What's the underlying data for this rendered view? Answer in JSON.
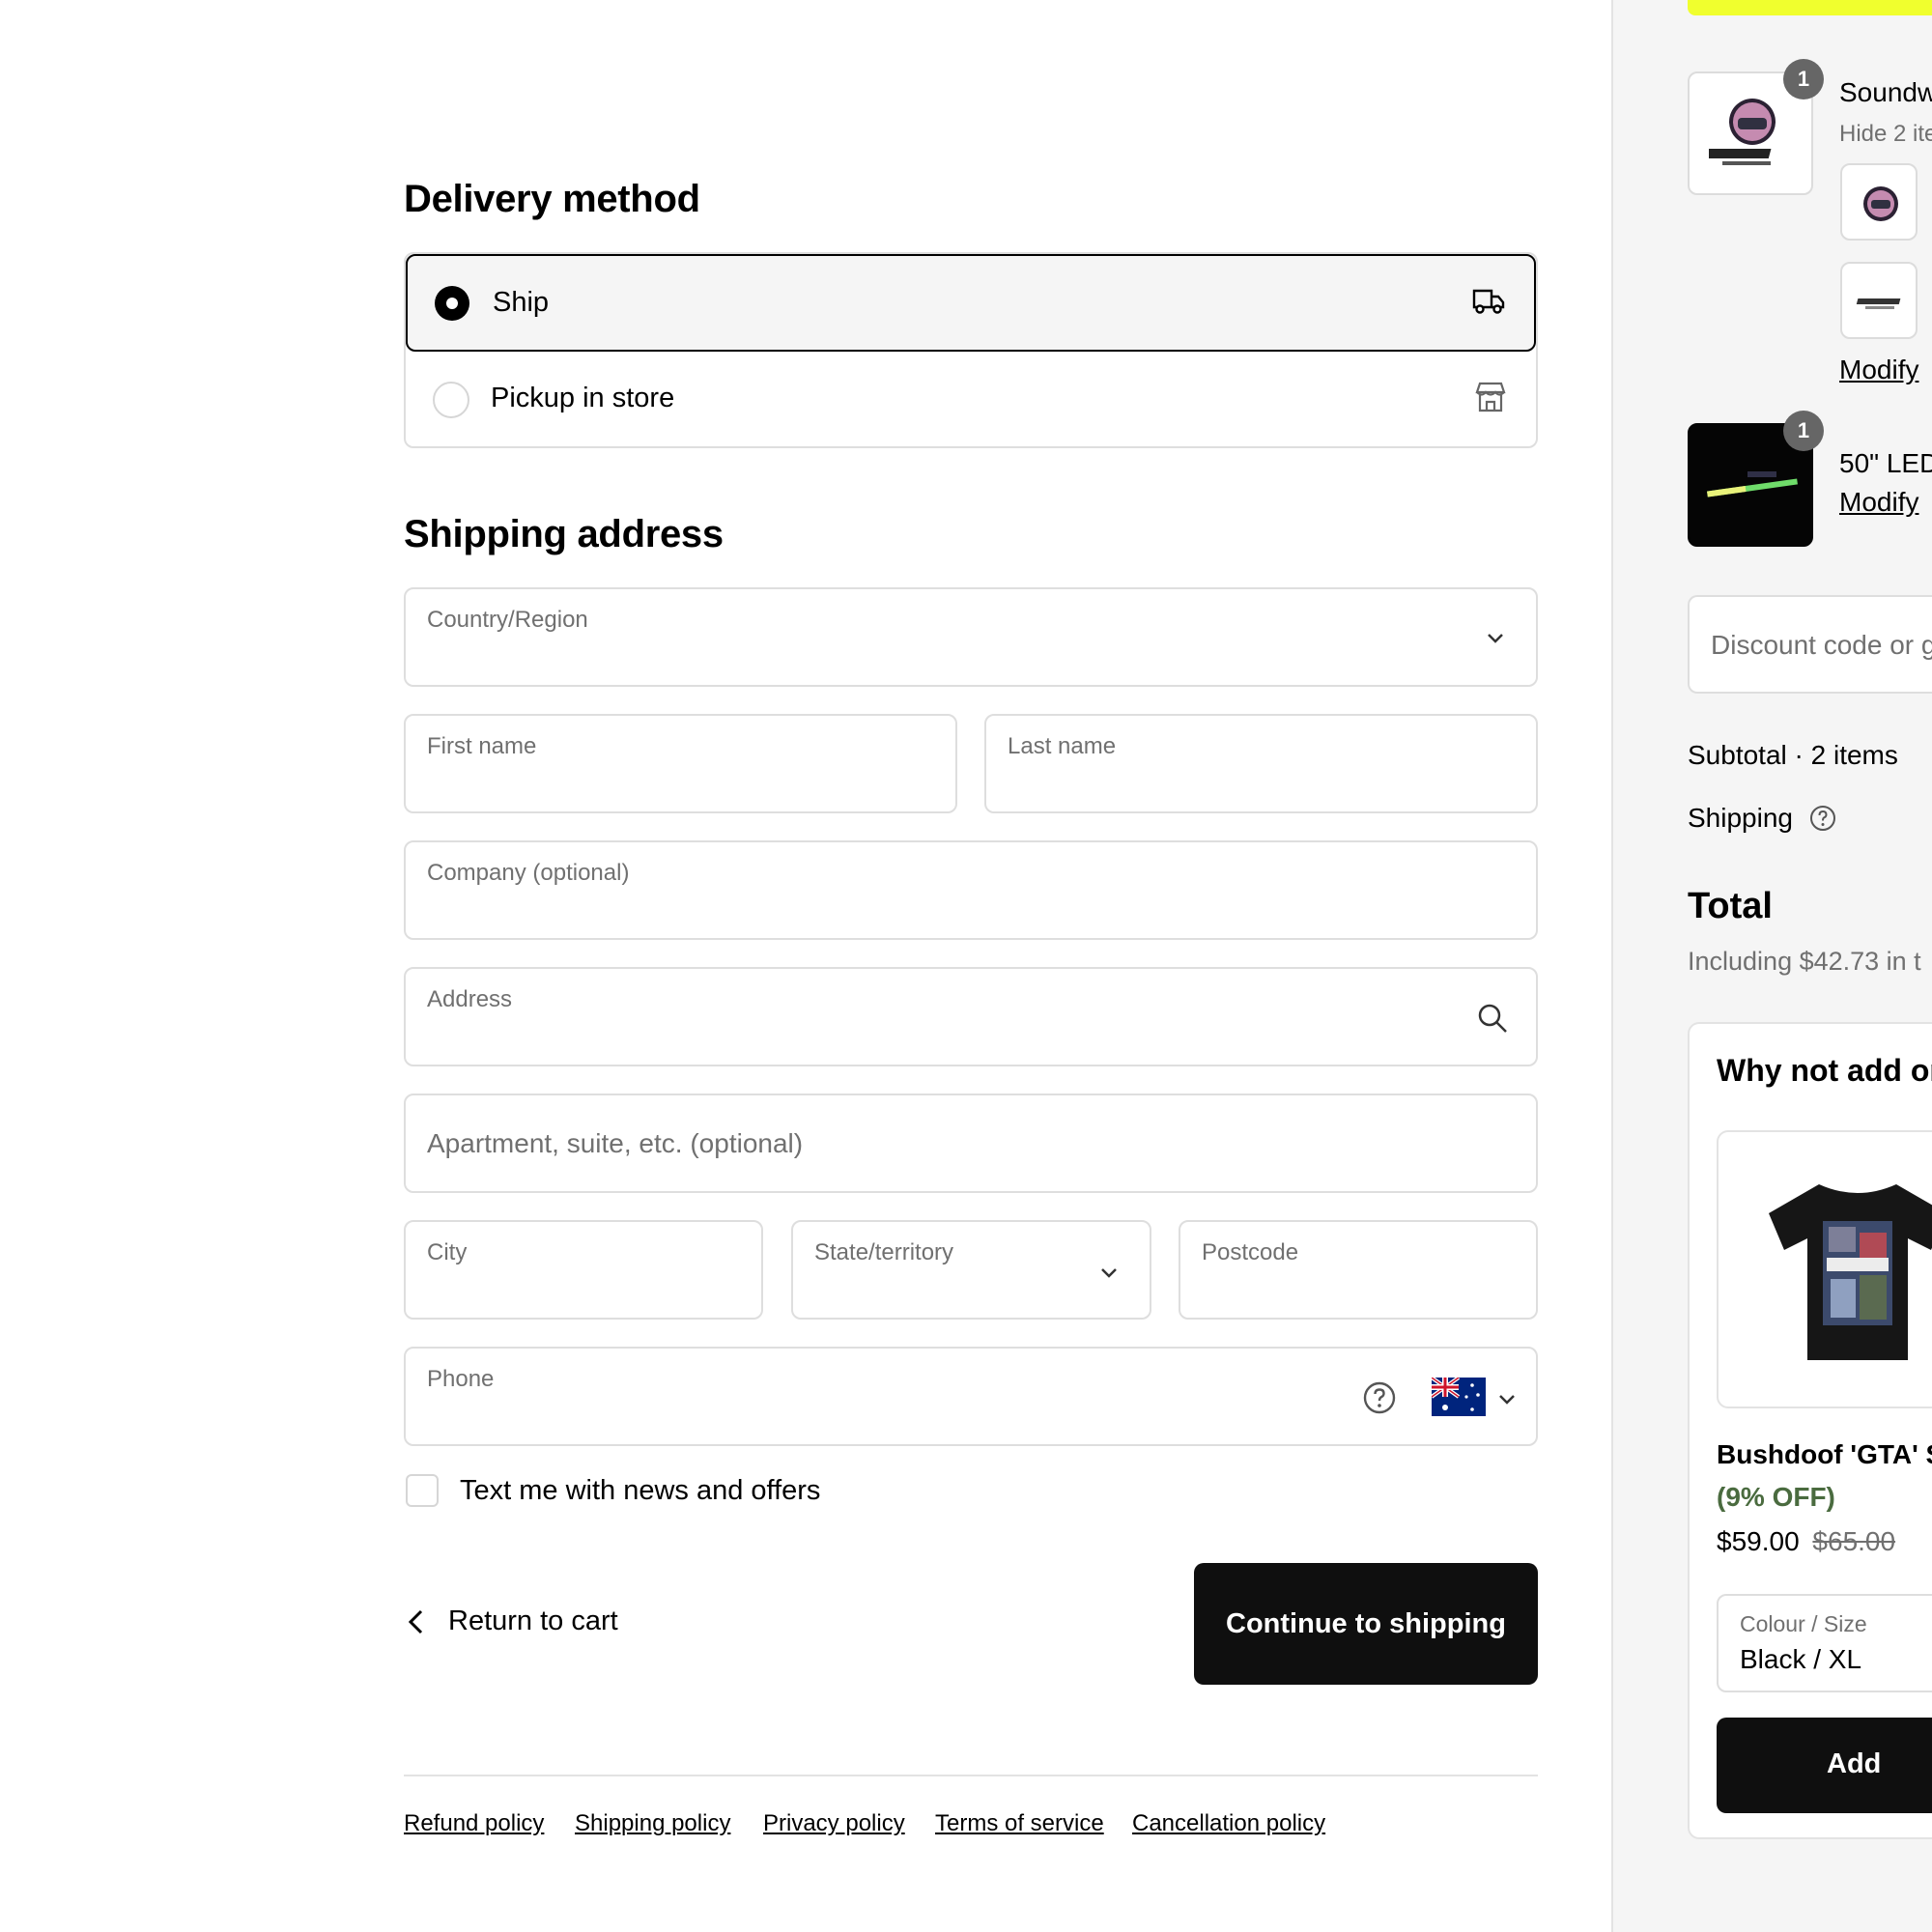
{
  "delivery": {
    "heading": "Delivery method",
    "options": [
      {
        "label": "Ship",
        "selected": true,
        "icon": "truck-icon"
      },
      {
        "label": "Pickup in store",
        "selected": false,
        "icon": "store-icon"
      }
    ]
  },
  "shipping": {
    "heading": "Shipping address",
    "country_label": "Country/Region",
    "first_name_label": "First name",
    "last_name_label": "Last name",
    "company_label": "Company (optional)",
    "address_label": "Address",
    "apartment_placeholder": "Apartment, suite, etc. (optional)",
    "city_label": "City",
    "state_label": "State/territory",
    "postcode_label": "Postcode",
    "phone_label": "Phone",
    "sms_optin_label": "Text me with news and offers",
    "sms_optin_checked": false
  },
  "actions": {
    "return_label": "Return to cart",
    "continue_label": "Continue to shipping"
  },
  "footer": {
    "links": [
      "Refund policy",
      "Shipping policy",
      "Privacy policy",
      "Terms of service",
      "Cancellation policy"
    ]
  },
  "summary": {
    "items": [
      {
        "name": "Soundw",
        "qty": "1",
        "sub_label": "Hide 2 ite",
        "modify_label": "Modify"
      },
      {
        "name": "50\" LED",
        "qty": "1",
        "modify_label": "Modify"
      }
    ],
    "discount_placeholder": "Discount code or g",
    "subtotal_label": "Subtotal · 2 items",
    "shipping_label": "Shipping",
    "total_label": "Total",
    "tax_note": "Including $42.73 in t",
    "upsell": {
      "heading": "Why not add or",
      "product_name": "Bushdoof 'GTA' S",
      "discount": "(9% OFF)",
      "price": "$59.00",
      "compare_price": "$65.00",
      "variant_label": "Colour / Size",
      "variant_value": "Black / XL",
      "add_label": "Add"
    }
  },
  "colors": {
    "accent_yellow": "#f0ff2e",
    "discount_green": "#4a6b3f",
    "primary_button": "#0f0f0f"
  }
}
